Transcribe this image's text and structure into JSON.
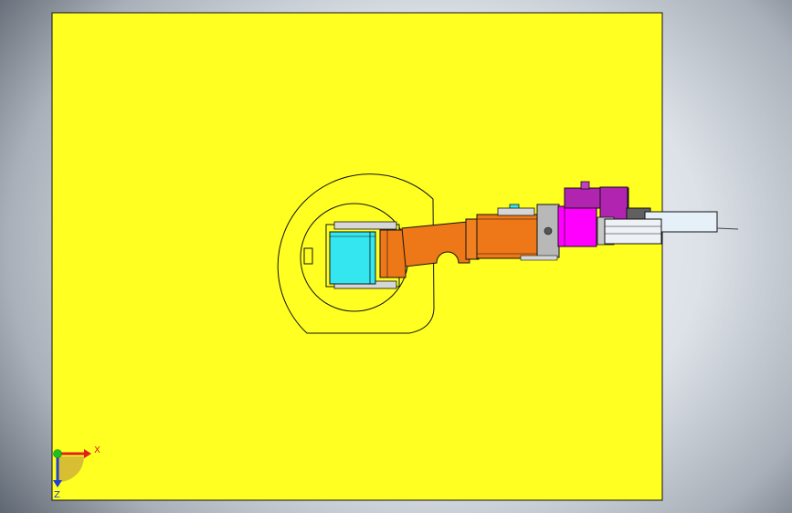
{
  "viewport": {
    "background_top": "#f2f4f7",
    "background_edge": "#3c434c"
  },
  "base_plate": {
    "color": "#ffff22"
  },
  "robot": {
    "link_color": "#ee7818",
    "gripper_color": "#ff00ff",
    "top_module_color": "#b024b0",
    "joint_cap_color": "#33e6f0",
    "tool_color": "#e6f0f8"
  },
  "triad": {
    "x_label": "X",
    "z_label": "Z",
    "x_icon": "x-axis-arrow-icon",
    "z_icon": "z-axis-arrow-icon",
    "y_icon": "y-axis-dot-icon",
    "x_color": "#e02020",
    "z_color": "#2040d0",
    "y_color": "#20c020"
  }
}
